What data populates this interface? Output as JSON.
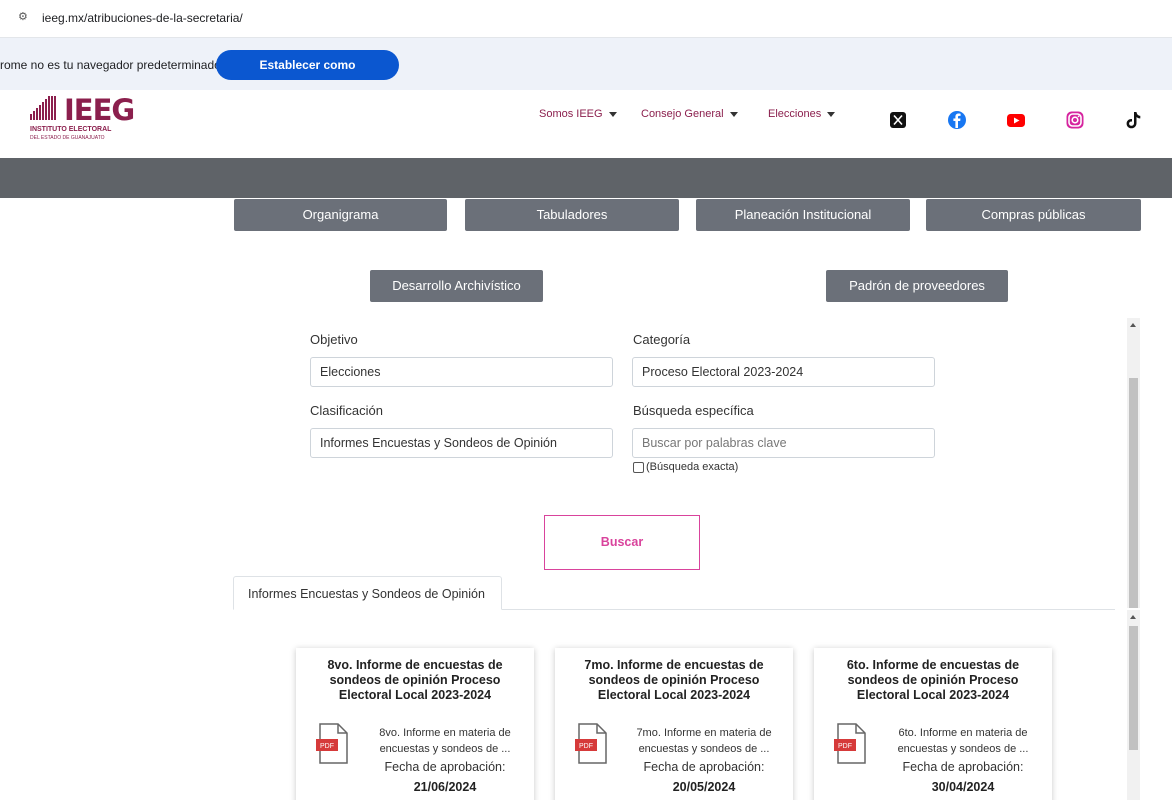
{
  "browser": {
    "url": "ieeg.mx/atribuciones-de-la-secretaria/",
    "infobar_message": "rome no es tu navegador predeterminado",
    "set_default_label": "Establecer como predeterminado"
  },
  "header": {
    "logo_acronym": "IEEG",
    "logo_line1": "INSTITUTO ELECTORAL",
    "logo_line2": "DEL ESTADO DE GUANAJUATO",
    "nav": [
      "Somos IEEG",
      "Consejo General",
      "Elecciones"
    ],
    "social_icons": [
      "x-icon",
      "facebook-icon",
      "youtube-icon",
      "instagram-icon",
      "tiktok-icon"
    ]
  },
  "subnav": {
    "buttons": [
      "Organigrama",
      "Tabuladores",
      "Planeación Institucional",
      "Compras públicas"
    ],
    "row2": [
      "Desarrollo Archivístico",
      "Padrón de proveedores"
    ]
  },
  "filters": {
    "objetivo_label": "Objetivo",
    "objetivo_value": "Elecciones",
    "categoria_label": "Categoría",
    "categoria_value": "Proceso Electoral 2023-2024",
    "clasificacion_label": "Clasificación",
    "clasificacion_value": "Informes Encuestas y Sondeos de Opinión",
    "busqueda_label": "Búsqueda específica",
    "busqueda_placeholder": "Buscar por palabras clave",
    "exact_label": "(Búsqueda exacta)",
    "search_button": "Buscar"
  },
  "results": {
    "tab_label": "Informes Encuestas y Sondeos de Opinión",
    "date_label": "Fecha de aprobación:",
    "file_badge": "PDF",
    "cards": [
      {
        "title": "8vo. Informe de encuestas de sondeos de opinión Proceso Electoral Local 2023-2024",
        "description": "8vo. Informe en materia de encuestas y sondeos de ...",
        "date": "21/06/2024"
      },
      {
        "title": "7mo. Informe de encuestas de sondeos de opinión Proceso Electoral Local 2023-2024",
        "description": "7mo. Informe en materia de encuestas y sondeos de ...",
        "date": "20/05/2024"
      },
      {
        "title": "6to. Informe de encuestas de sondeos de opinión Proceso Electoral Local 2023-2024",
        "description": "6to. Informe en materia de encuestas y sondeos de ...",
        "date": "30/04/2024"
      }
    ]
  },
  "colors": {
    "brand": "#8b1f4d",
    "search_accent": "#d9439c",
    "gray_button": "#6b7079",
    "infobar_button": "#0b57d0"
  }
}
